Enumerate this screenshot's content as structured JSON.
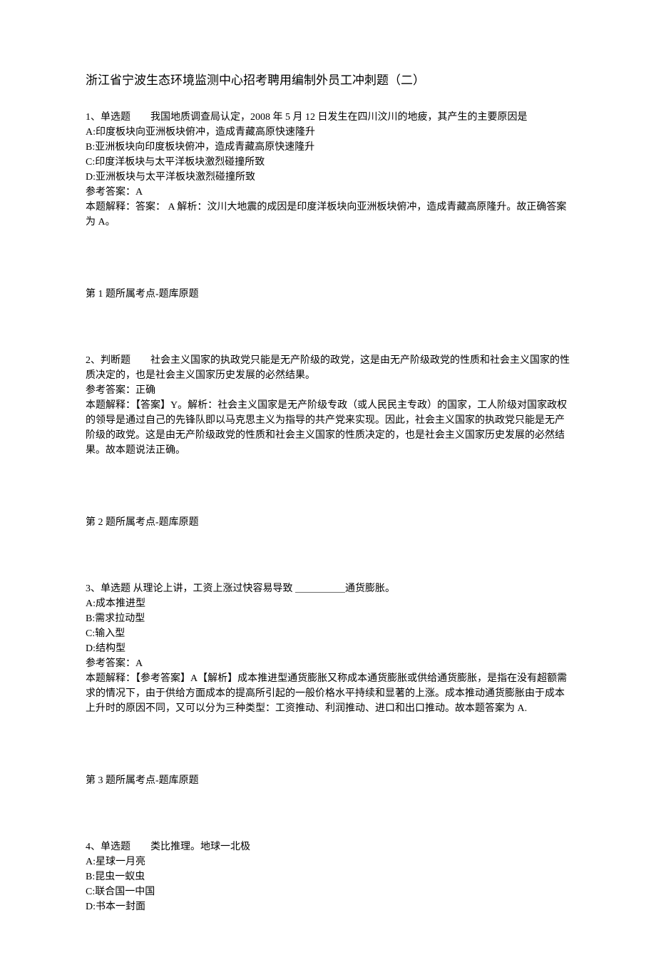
{
  "title": "浙江省宁波生态环境监测中心招考聘用编制外员工冲刺题（二）",
  "questions": [
    {
      "header": "1、单选题　　我国地质调查局认定，2008 年 5 月 12 日发生在四川汶川的地疲，其产生的主要原因是",
      "options": [
        "A:印度板块向亚洲板块俯冲，造成青藏高原快速隆升",
        "B:亚洲板块向印度板块俯冲，造成青藏高原快速隆升",
        "C:印度洋板块与太平洋板块激烈碰撞所致",
        "D:亚洲板块与太平洋板块激烈碰撞所致"
      ],
      "answer_label": "参考答案：A",
      "explain_lines": [
        "本题解释：答案： A 解析：汶川大地震的成因是印度洋板块向亚洲板块俯冲，造成青藏高原隆升。故正确答案为 A。"
      ],
      "footer": "第 1 题所属考点-题库原题"
    },
    {
      "header": "2、判断题　　社会主义国家的执政党只能是无产阶级的政党，这是由无产阶级政党的性质和社会主义国家的性质决定的，也是社会主义国家历史发展的必然结果。",
      "options": [],
      "answer_label": "参考答案：正确",
      "explain_lines": [
        "本题解释：【答案】Y。解析：社会主义国家是无产阶级专政（或人民民主专政）的国家，工人阶级对国家政权的领导是通过自己的先锋队即以马克思主义为指导的共产党来实现。因此，社会主义国家的执政党只能是无产阶级的政党。这是由无产阶级政党的性质和社会主义国家的性质决定的，也是社会主义国家历史发展的必然结果。故本题说法正确。"
      ],
      "footer": "第 2 题所属考点-题库原题"
    },
    {
      "header": "3、单选题 从理论上讲，工资上涨过快容易导致 ＿＿＿＿＿通货膨胀。",
      "options": [
        "A:成本推进型",
        "B:需求拉动型",
        "C:输入型",
        "D:结构型"
      ],
      "answer_label": "参考答案：A",
      "explain_lines": [
        "本题解释：【参考答案】A【解析】成本推进型通货膨胀又称成本通货膨胀或供给通货膨胀，是指在没有超额需求的情况下，由于供给方面成本的提高所引起的一般价格水平持续和显著的上涨。成本推动通货膨胀由于成本上升时的原因不同，又可以分为三种类型：工资推动、利润推动、进口和出口推动。故本题答案为 A."
      ],
      "footer": "第 3 题所属考点-题库原题"
    },
    {
      "header": "4、单选题　　类比推理。地球一北极",
      "options": [
        "A:星球一月亮",
        "B:昆虫一蚁虫",
        "C:联合国一中国",
        "D:书本一封面"
      ],
      "answer_label": "",
      "explain_lines": [],
      "footer": ""
    }
  ]
}
